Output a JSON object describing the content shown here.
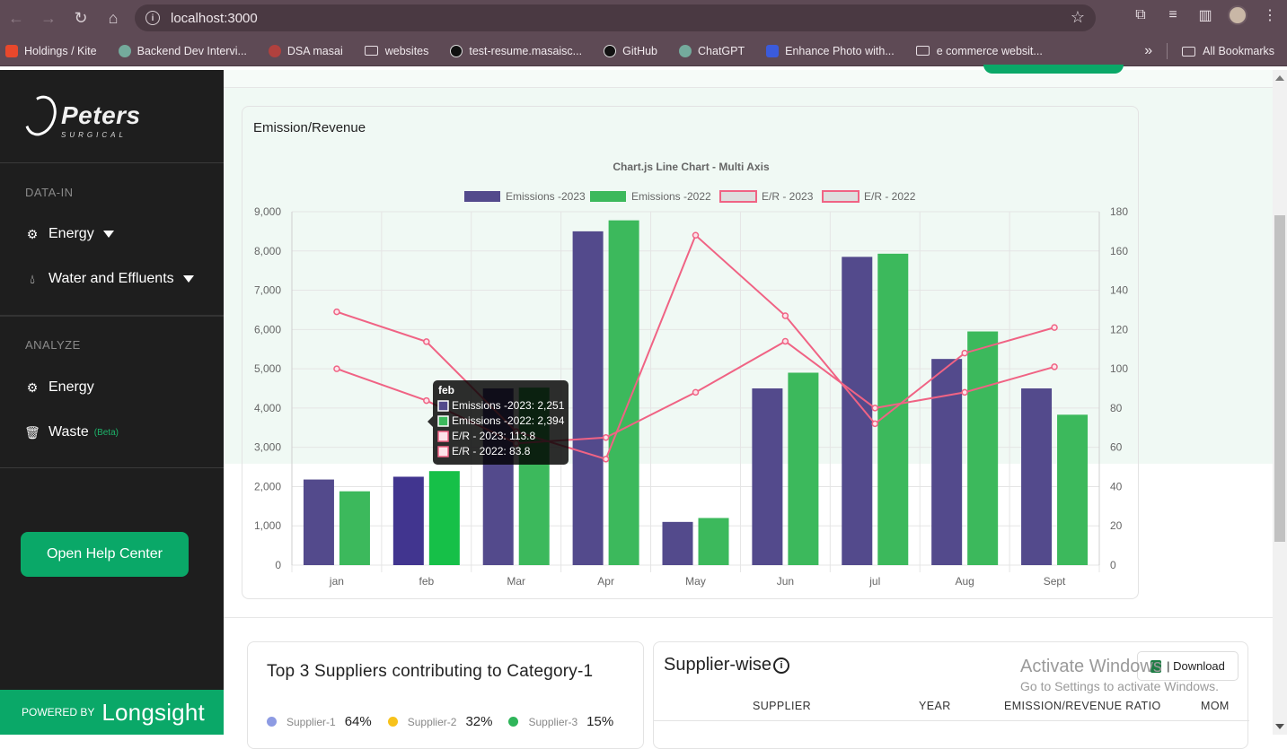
{
  "browser": {
    "url": "localhost:3000",
    "bookmarks": [
      {
        "label": "Holdings / Kite",
        "color": "#e8482c"
      },
      {
        "label": "Backend Dev Intervi...",
        "color": "#74aa9c"
      },
      {
        "label": "DSA masai",
        "color": "#b0413e"
      },
      {
        "label": "websites",
        "color": "folder"
      },
      {
        "label": "test-resume.masaisc...",
        "color": "#111111"
      },
      {
        "label": "GitHub",
        "color": "#111111"
      },
      {
        "label": "ChatGPT",
        "color": "#74aa9c"
      },
      {
        "label": "Enhance Photo with...",
        "color": "#3b5bdb"
      },
      {
        "label": "e commerce websit...",
        "color": "folder"
      }
    ],
    "more_label": "»",
    "all_bookmarks": "All Bookmarks"
  },
  "sidebar": {
    "brand": "Peters",
    "brand_sub": "SURGICAL",
    "sections": [
      {
        "title": "DATA-IN",
        "items": [
          {
            "label": "Energy",
            "icon": "gear-icon",
            "dropdown": true
          },
          {
            "label": "Water and Effluents",
            "icon": "droplet-icon",
            "dropdown": true
          }
        ]
      },
      {
        "title": "ANALYZE",
        "items": [
          {
            "label": "Energy",
            "icon": "gear-icon"
          },
          {
            "label": "Waste",
            "icon": "trash-icon",
            "badge": "(Beta)"
          }
        ]
      }
    ],
    "help_button": "Open Help Center",
    "powered_by": "POWERED BY",
    "powered_brand": "Longsight"
  },
  "card": {
    "title": "Emission/Revenue"
  },
  "chart_data": {
    "type": "bar",
    "title": "Chart.js Line Chart - Multi Axis",
    "categories": [
      "jan",
      "feb",
      "Mar",
      "Apr",
      "May",
      "Jun",
      "jul",
      "Aug",
      "Sept"
    ],
    "series": [
      {
        "name": "Emissions -2023",
        "type": "bar",
        "axis": "left",
        "color": "#534a8c",
        "values": [
          2180,
          2251,
          4500,
          8500,
          1100,
          4500,
          7850,
          5250,
          4500
        ]
      },
      {
        "name": "Emissions -2022",
        "type": "bar",
        "axis": "left",
        "color": "#3cb95c",
        "values": [
          1880,
          2394,
          4520,
          8780,
          1200,
          4900,
          7930,
          5950,
          3830
        ]
      },
      {
        "name": "E/R - 2023",
        "type": "line",
        "axis": "right",
        "color": "#f06384",
        "values": [
          129,
          113.8,
          68,
          54,
          168,
          127,
          72,
          108,
          121
        ]
      },
      {
        "name": "E/R - 2022",
        "type": "line",
        "axis": "right",
        "color": "#f06384",
        "values": [
          100,
          83.8,
          62,
          65,
          88,
          114,
          80,
          88,
          101
        ]
      }
    ],
    "y_left": {
      "min": 0,
      "max": 9000,
      "ticks": [
        "0",
        "1,000",
        "2,000",
        "3,000",
        "4,000",
        "5,000",
        "6,000",
        "7,000",
        "8,000",
        "9,000"
      ]
    },
    "y_right": {
      "min": 0,
      "max": 180,
      "ticks": [
        "0",
        "20",
        "40",
        "60",
        "80",
        "100",
        "120",
        "140",
        "160",
        "180"
      ]
    },
    "legend": "top",
    "grid": true,
    "tooltip": {
      "category": "feb",
      "lines": [
        "Emissions -2023: 2,251",
        "Emissions -2022: 2,394",
        "E/R - 2023: 113.8",
        "E/R - 2022: 83.8"
      ]
    }
  },
  "suppliers_card": {
    "title": "Top 3 Suppliers contributing to Category-1",
    "items": [
      {
        "label": "Supplier-1",
        "pct": "64%",
        "color": "#8d9be3"
      },
      {
        "label": "Supplier-2",
        "pct": "32%",
        "color": "#f7c21b"
      },
      {
        "label": "Supplier-3",
        "pct": "15%",
        "color": "#2fb55a"
      }
    ]
  },
  "supplier_wise": {
    "title": "Supplier-wise",
    "info": "i",
    "download": "| Download",
    "columns": [
      "SUPPLIER",
      "YEAR",
      "EMISSION/REVENUE RATIO",
      "MOM"
    ]
  },
  "watermark": {
    "line1": "Activate Windows",
    "line2": "Go to Settings to activate Windows."
  }
}
